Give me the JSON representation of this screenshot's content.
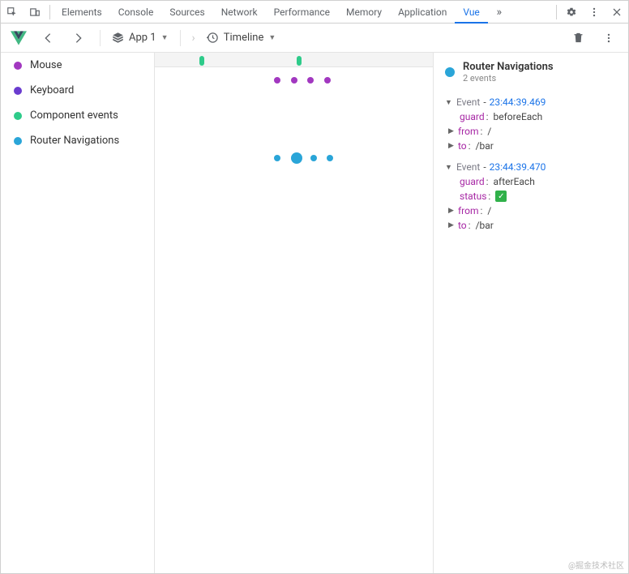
{
  "devtools": {
    "tabs": [
      "Elements",
      "Console",
      "Sources",
      "Network",
      "Performance",
      "Memory",
      "Application",
      "Vue"
    ],
    "active_tab": "Vue"
  },
  "toolbar": {
    "app_label": "App 1",
    "view_label": "Timeline"
  },
  "layers": [
    {
      "label": "Mouse",
      "color": "#a238c0"
    },
    {
      "label": "Keyboard",
      "color": "#6a3ccf"
    },
    {
      "label": "Component events",
      "color": "#2ecb8a"
    },
    {
      "label": "Router Navigations",
      "color": "#2aa5d8"
    }
  ],
  "timeline": {
    "ruler_marks": [
      {
        "left_pct": 16,
        "color": "#2ecb8a"
      },
      {
        "left_pct": 51,
        "color": "#2ecb8a"
      }
    ],
    "lanes": [
      {
        "layer": "Mouse",
        "dots": [
          {
            "left_pct": 44,
            "size": 8,
            "color": "#a238c0"
          },
          {
            "left_pct": 50,
            "size": 8,
            "color": "#a238c0"
          },
          {
            "left_pct": 56,
            "size": 8,
            "color": "#a238c0"
          },
          {
            "left_pct": 62,
            "size": 8,
            "color": "#a238c0"
          }
        ]
      },
      {
        "layer": "Keyboard",
        "dots": []
      },
      {
        "layer": "Component events",
        "dots": []
      },
      {
        "layer": "Router Navigations",
        "dots": [
          {
            "left_pct": 44,
            "size": 8,
            "color": "#2aa5d8"
          },
          {
            "left_pct": 51,
            "size": 14,
            "color": "#2aa5d8"
          },
          {
            "left_pct": 57,
            "size": 8,
            "color": "#2aa5d8"
          },
          {
            "left_pct": 63,
            "size": 8,
            "color": "#2aa5d8"
          }
        ]
      }
    ]
  },
  "inspector": {
    "title": "Router Navigations",
    "subtitle": "2 events",
    "dot_color": "#2aa5d8",
    "events": [
      {
        "name": "Event",
        "time": "23:44:39.469",
        "rows": [
          {
            "expandable": false,
            "key": "guard",
            "value": "beforeEach"
          },
          {
            "expandable": true,
            "key": "from",
            "value": "/"
          },
          {
            "expandable": true,
            "key": "to",
            "value": "/bar"
          }
        ]
      },
      {
        "name": "Event",
        "time": "23:44:39.470",
        "rows": [
          {
            "expandable": false,
            "key": "guard",
            "value": "afterEach"
          },
          {
            "expandable": false,
            "key": "status",
            "check": true
          },
          {
            "expandable": true,
            "key": "from",
            "value": "/"
          },
          {
            "expandable": true,
            "key": "to",
            "value": "/bar"
          }
        ]
      }
    ]
  },
  "watermark": "@掘金技术社区"
}
